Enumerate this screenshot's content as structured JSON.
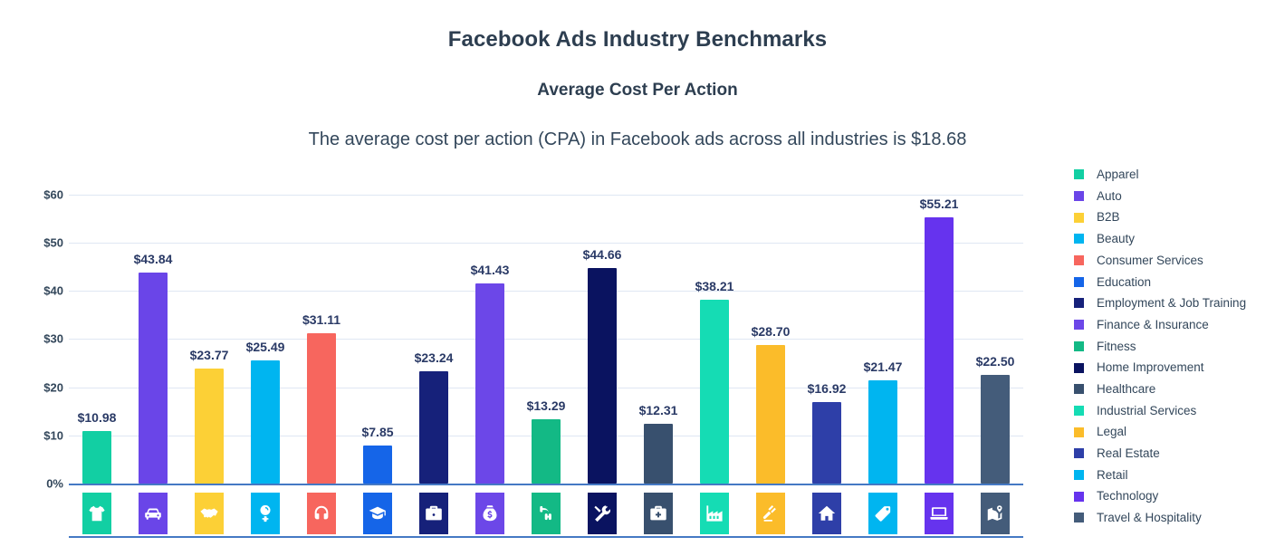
{
  "header": {
    "title": "Facebook Ads Industry Benchmarks",
    "subtitle": "Average Cost Per Action",
    "description": "The average cost per action (CPA) in Facebook ads across all industries is $18.68"
  },
  "chart_data": {
    "type": "bar",
    "title": "Facebook Ads Industry Benchmarks",
    "subtitle": "Average Cost Per Action",
    "annotation": "The average cost per action (CPA) in Facebook ads across all industries is $18.68",
    "average_cpa": 18.68,
    "xlabel": "",
    "ylabel": "",
    "ylim": [
      0,
      60
    ],
    "grid": true,
    "legend_position": "right",
    "y_ticks": [
      {
        "value": 60,
        "label": "$60"
      },
      {
        "value": 50,
        "label": "$50"
      },
      {
        "value": 40,
        "label": "$40"
      },
      {
        "value": 30,
        "label": "$30"
      },
      {
        "value": 20,
        "label": "$20"
      },
      {
        "value": 10,
        "label": "$10"
      },
      {
        "value": 0,
        "label": "0%"
      }
    ],
    "categories": [
      "Apparel",
      "Auto",
      "B2B",
      "Beauty",
      "Consumer Services",
      "Education",
      "Employment & Job Training",
      "Finance & Insurance",
      "Fitness",
      "Home Improvement",
      "Healthcare",
      "Industrial Services",
      "Legal",
      "Real Estate",
      "Retail",
      "Technology",
      "Travel & Hospitality"
    ],
    "values": [
      10.98,
      43.84,
      23.77,
      25.49,
      31.11,
      7.85,
      23.24,
      41.43,
      13.29,
      44.66,
      12.31,
      38.21,
      28.7,
      16.92,
      21.47,
      55.21,
      22.5
    ],
    "value_labels": [
      "$10.98",
      "$43.84",
      "$23.77",
      "$25.49",
      "$31.11",
      "$7.85",
      "$23.24",
      "$41.43",
      "$13.29",
      "$44.66",
      "$12.31",
      "$38.21",
      "$28.70",
      "$16.92",
      "$21.47",
      "$55.21",
      "$22.50"
    ],
    "colors": [
      "#12cfa3",
      "#6a45e8",
      "#fcd036",
      "#00b5f0",
      "#f7665e",
      "#1565e8",
      "#16217a",
      "#6c47e8",
      "#13b985",
      "#0a1360",
      "#38506e",
      "#15dcb4",
      "#fbbc2a",
      "#2e3fa8",
      "#00b5f0",
      "#6633ee",
      "#445c7a"
    ],
    "icons": [
      "tshirt-icon",
      "car-icon",
      "handshake-icon",
      "mirror-icon",
      "headset-icon",
      "graduation-cap-icon",
      "briefcase-icon",
      "money-bag-icon",
      "dumbbell-icon",
      "tools-icon",
      "medical-kit-icon",
      "factory-icon",
      "gavel-icon",
      "house-icon",
      "price-tag-icon",
      "laptop-icon",
      "map-pin-icon"
    ],
    "axis_color": "#4579c4",
    "gridline_color": "#dfe7f3"
  },
  "legend": {
    "items": [
      {
        "label": "Apparel",
        "color": "#12cfa3"
      },
      {
        "label": "Auto",
        "color": "#6a45e8"
      },
      {
        "label": "B2B",
        "color": "#fcd036"
      },
      {
        "label": "Beauty",
        "color": "#00b5f0"
      },
      {
        "label": "Consumer Services",
        "color": "#f7665e"
      },
      {
        "label": "Education",
        "color": "#1565e8"
      },
      {
        "label": "Employment & Job Training",
        "color": "#16217a"
      },
      {
        "label": "Finance & Insurance",
        "color": "#6c47e8"
      },
      {
        "label": "Fitness",
        "color": "#13b985"
      },
      {
        "label": "Home Improvement",
        "color": "#0a1360"
      },
      {
        "label": "Healthcare",
        "color": "#38506e"
      },
      {
        "label": "Industrial Services",
        "color": "#15dcb4"
      },
      {
        "label": "Legal",
        "color": "#fbbc2a"
      },
      {
        "label": "Real Estate",
        "color": "#2e3fa8"
      },
      {
        "label": "Retail",
        "color": "#00b5f0"
      },
      {
        "label": "Technology",
        "color": "#6633ee"
      },
      {
        "label": "Travel & Hospitality",
        "color": "#445c7a"
      }
    ]
  }
}
